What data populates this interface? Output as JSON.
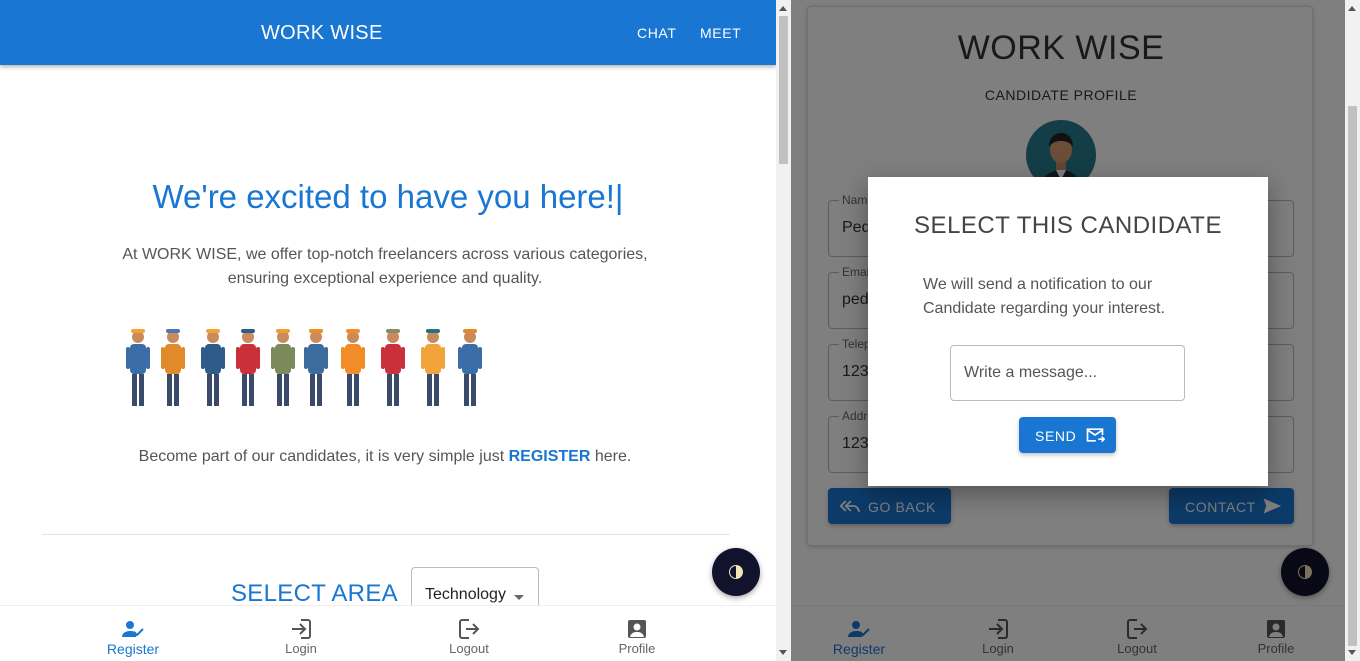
{
  "left": {
    "appbar": {
      "brand": "WORK WISE",
      "nav": [
        "CHAT",
        "MEET"
      ]
    },
    "hero": {
      "title": "We're excited to have you here!|",
      "text": "At WORK WISE, we offer top-notch freelancers across various categories, ensuring exceptional experience and quality."
    },
    "register_line": {
      "before": "Become part of our candidates, it is very simple just ",
      "link": "REGISTER",
      "after": " here."
    },
    "area": {
      "label": "SELECT AREA",
      "selected": "Technology"
    }
  },
  "bottom_nav": [
    "Register",
    "Login",
    "Logout",
    "Profile"
  ],
  "right": {
    "card": {
      "brand": "WORK WISE",
      "subtitle": "CANDIDATE PROFILE",
      "fields": [
        {
          "label": "Name",
          "value": "Ped"
        },
        {
          "label": "Email",
          "value": "ped"
        },
        {
          "label": "Telep",
          "value": "123"
        },
        {
          "label": "Addre",
          "value": "123"
        }
      ],
      "go_back": "GO BACK",
      "contact": "CONTACT"
    },
    "dialog": {
      "title": "SELECT THIS CANDIDATE",
      "text": "We will send a notification to our Candidate regarding your interest.",
      "placeholder": "Write a message...",
      "send": "SEND"
    }
  },
  "colors": {
    "primary": "#1976d2",
    "theme_button": "#10132b"
  }
}
